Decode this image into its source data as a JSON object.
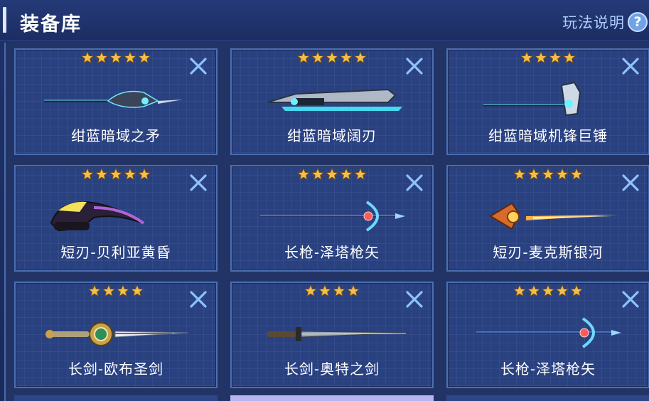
{
  "header": {
    "title": "装备库",
    "help_label": "玩法说明",
    "help_icon": "question-icon"
  },
  "colors": {
    "background": "#1f3168",
    "card": "#2a4180",
    "card_border": "#4d6fb2",
    "star": "#f2c04a",
    "close": "#8fc2ff",
    "help_text": "#aeccff"
  },
  "cards": [
    {
      "name": "绀蓝暗域之矛",
      "stars": 5,
      "icon": "spear-icon"
    },
    {
      "name": "绀蓝暗域阔刃",
      "stars": 5,
      "icon": "broadblade-icon"
    },
    {
      "name": "绀蓝暗域机锋巨锤",
      "stars": 4,
      "icon": "hammer-icon"
    },
    {
      "name": "短刃-贝利亚黄昏",
      "stars": 5,
      "icon": "scythe-dagger-icon"
    },
    {
      "name": "长枪-泽塔枪矢",
      "stars": 5,
      "icon": "bow-spear-icon"
    },
    {
      "name": "短刃-麦克斯银河",
      "stars": 5,
      "icon": "flame-dagger-icon"
    },
    {
      "name": "长剑-欧布圣剑",
      "stars": 4,
      "icon": "holy-sword-icon"
    },
    {
      "name": "长剑-奥特之剑",
      "stars": 4,
      "icon": "long-sword-icon"
    },
    {
      "name": "长枪-泽塔枪矢",
      "stars": 5,
      "icon": "bow-spear-icon"
    }
  ]
}
